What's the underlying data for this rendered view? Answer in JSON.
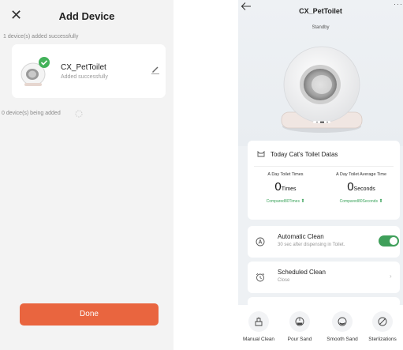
{
  "left_screen": {
    "title": "Add Device",
    "added_caption": "1 device(s) added successfully",
    "device": {
      "name": "CX_PetToilet",
      "status": "Added successfully"
    },
    "adding_caption": "0 device(s) being added",
    "done_label": "Done",
    "colors": {
      "accent": "#e9653f",
      "success": "#43b25a"
    }
  },
  "right_screen": {
    "title": "CX_PetToilet",
    "status": "Standby",
    "more_label": "···",
    "data_card": {
      "heading": "Today Cat's Toilet Datas",
      "stats": [
        {
          "label": "A Day Toilet Times",
          "value": "0",
          "unit": "Times",
          "compare": "Compared80Times",
          "arrow": "⬆"
        },
        {
          "label": "A Day Toilet Average Time",
          "value": "0",
          "unit": "Seconds",
          "compare": "Compared80Seconds",
          "arrow": "⬆"
        }
      ]
    },
    "automatic_clean": {
      "title": "Automatic Clean",
      "subtitle": "30 sec after dispensing in Toilet.",
      "enabled": true
    },
    "scheduled_clean": {
      "title": "Scheduled Clean",
      "subtitle": "Close",
      "chevron": "›"
    },
    "actions": [
      {
        "label": "Manual Clean",
        "icon": "manual-clean-icon"
      },
      {
        "label": "Pour Sand",
        "icon": "pour-sand-icon"
      },
      {
        "label": "Smooth Sand",
        "icon": "smooth-sand-icon"
      },
      {
        "label": "Sterlizations",
        "icon": "sterilization-icon"
      }
    ],
    "colors": {
      "toggle_on": "#3f9f5a",
      "compare_green": "#3aa35a"
    }
  }
}
